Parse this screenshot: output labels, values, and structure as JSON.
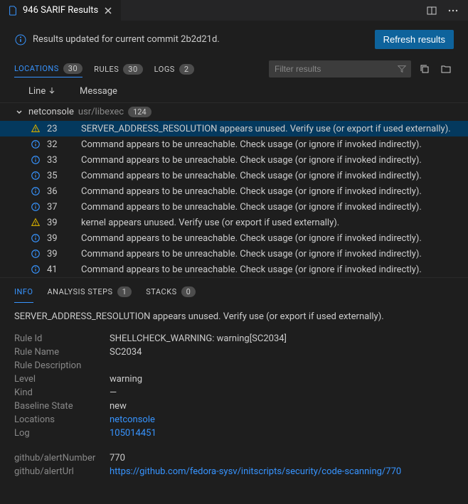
{
  "tab": {
    "label": "946 SARIF Results"
  },
  "status": {
    "message": "Results updated for current commit 2b2d21d.",
    "refresh_label": "Refresh results"
  },
  "toolbar": {
    "locations": {
      "label": "LOCATIONS",
      "count": "30"
    },
    "rules": {
      "label": "RULES",
      "count": "30"
    },
    "logs": {
      "label": "LOGS",
      "count": "2"
    },
    "filter_placeholder": "Filter results"
  },
  "table": {
    "col_line": "Line",
    "col_message": "Message"
  },
  "group": {
    "title": "netconsole",
    "path": "usr/libexec",
    "count": "124"
  },
  "rows": [
    {
      "severity": "warning",
      "line": "23",
      "message": "SERVER_ADDRESS_RESOLUTION appears unused. Verify use (or export if used externally).",
      "selected": true
    },
    {
      "severity": "info",
      "line": "32",
      "message": "Command appears to be unreachable. Check usage (or ignore if invoked indirectly)."
    },
    {
      "severity": "info",
      "line": "33",
      "message": "Command appears to be unreachable. Check usage (or ignore if invoked indirectly)."
    },
    {
      "severity": "info",
      "line": "35",
      "message": "Command appears to be unreachable. Check usage (or ignore if invoked indirectly)."
    },
    {
      "severity": "info",
      "line": "36",
      "message": "Command appears to be unreachable. Check usage (or ignore if invoked indirectly)."
    },
    {
      "severity": "info",
      "line": "37",
      "message": "Command appears to be unreachable. Check usage (or ignore if invoked indirectly)."
    },
    {
      "severity": "warning",
      "line": "39",
      "message": "kernel appears unused. Verify use (or export if used externally)."
    },
    {
      "severity": "info",
      "line": "39",
      "message": "Command appears to be unreachable. Check usage (or ignore if invoked indirectly)."
    },
    {
      "severity": "info",
      "line": "39",
      "message": "Command appears to be unreachable. Check usage (or ignore if invoked indirectly)."
    },
    {
      "severity": "info",
      "line": "41",
      "message": "Command appears to be unreachable. Check usage (or ignore if invoked indirectly)."
    }
  ],
  "detail_tabs": {
    "info": {
      "label": "INFO"
    },
    "analysis": {
      "label": "ANALYSIS STEPS",
      "count": "1"
    },
    "stacks": {
      "label": "STACKS",
      "count": "0"
    }
  },
  "detail": {
    "message": "SERVER_ADDRESS_RESOLUTION appears unused. Verify use (or export if used externally).",
    "rules": [
      {
        "label": "Rule Id",
        "value": "SHELLCHECK_WARNING: warning[SC2034]"
      },
      {
        "label": "Rule Name",
        "value": "SC2034"
      },
      {
        "label": "Rule Description",
        "value": ""
      },
      {
        "label": "Level",
        "value": "warning"
      },
      {
        "label": "Kind",
        "value": "—"
      },
      {
        "label": "Baseline State",
        "value": "new"
      },
      {
        "label": "Locations",
        "value": "netconsole",
        "link": true
      },
      {
        "label": "Log",
        "value": "105014451",
        "link": true
      }
    ],
    "github": [
      {
        "label": "github/alertNumber",
        "value": "770"
      },
      {
        "label": "github/alertUrl",
        "value": "https://github.com/fedora-sysv/initscripts/security/code-scanning/770",
        "link": true
      }
    ]
  }
}
